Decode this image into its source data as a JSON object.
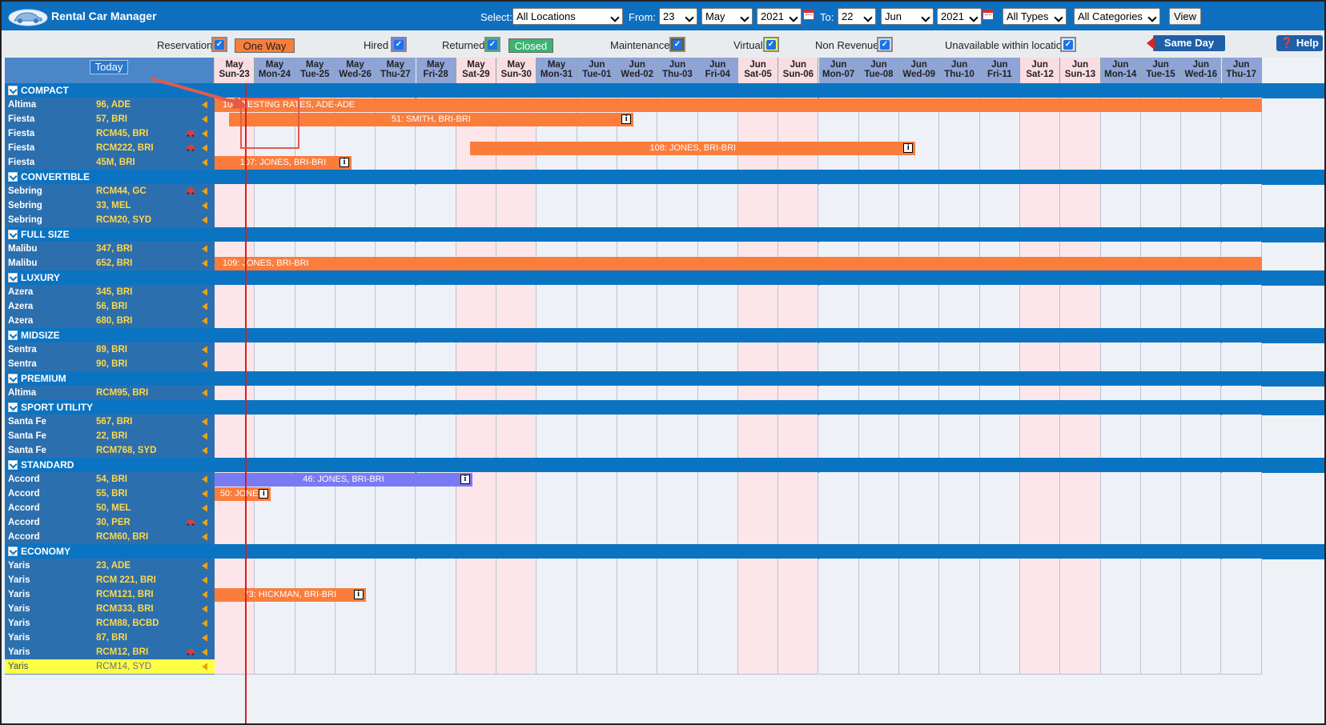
{
  "app": {
    "title": "Rental Car Manager"
  },
  "filters": {
    "select_label": "Select:",
    "location": "All Locations",
    "from_label": "From:",
    "from_day": "23",
    "from_month": "May",
    "from_year": "2021",
    "to_label": "To:",
    "to_day": "22",
    "to_month": "Jun",
    "to_year": "2021",
    "types": "All Types",
    "categories": "All Categories",
    "view_label": "View"
  },
  "legend": {
    "reservation_label": "Reservation",
    "one_way_label": "One Way",
    "hired_label": "Hired",
    "returned_label": "Returned",
    "closed_label": "Closed",
    "maintenance_label": "Maintenance",
    "virtual_label": "Virtual",
    "non_revenue_label": "Non Revenue",
    "unavailable_label": "Unavailable within location",
    "same_day_label": "Same Day",
    "help_label": "Help"
  },
  "colors": {
    "reservation": "#fa7d3c",
    "hired": "#7a7af5",
    "returned": "#7a7af5",
    "closed": "#3cb371",
    "maintenance": "#6b5a1a",
    "virtual": "#ffff44",
    "non_revenue": "#cfd8e3",
    "header_blue": "#0f6fbf"
  },
  "today_label": "Today",
  "days": [
    {
      "m": "May",
      "d": "Sun-23",
      "we": true
    },
    {
      "m": "May",
      "d": "Mon-24",
      "we": false
    },
    {
      "m": "May",
      "d": "Tue-25",
      "we": false
    },
    {
      "m": "May",
      "d": "Wed-26",
      "we": false
    },
    {
      "m": "May",
      "d": "Thu-27",
      "we": false
    },
    {
      "m": "May",
      "d": "Fri-28",
      "we": false
    },
    {
      "m": "May",
      "d": "Sat-29",
      "we": true
    },
    {
      "m": "May",
      "d": "Sun-30",
      "we": true
    },
    {
      "m": "May",
      "d": "Mon-31",
      "we": false
    },
    {
      "m": "Jun",
      "d": "Tue-01",
      "we": false
    },
    {
      "m": "Jun",
      "d": "Wed-02",
      "we": false
    },
    {
      "m": "Jun",
      "d": "Thu-03",
      "we": false
    },
    {
      "m": "Jun",
      "d": "Fri-04",
      "we": false
    },
    {
      "m": "Jun",
      "d": "Sat-05",
      "we": true
    },
    {
      "m": "Jun",
      "d": "Sun-06",
      "we": true
    },
    {
      "m": "Jun",
      "d": "Mon-07",
      "we": false
    },
    {
      "m": "Jun",
      "d": "Tue-08",
      "we": false
    },
    {
      "m": "Jun",
      "d": "Wed-09",
      "we": false
    },
    {
      "m": "Jun",
      "d": "Thu-10",
      "we": false
    },
    {
      "m": "Jun",
      "d": "Fri-11",
      "we": false
    },
    {
      "m": "Jun",
      "d": "Sat-12",
      "we": true
    },
    {
      "m": "Jun",
      "d": "Sun-13",
      "we": true
    },
    {
      "m": "Jun",
      "d": "Mon-14",
      "we": false
    },
    {
      "m": "Jun",
      "d": "Tue-15",
      "we": false
    },
    {
      "m": "Jun",
      "d": "Wed-16",
      "we": false
    },
    {
      "m": "Jun",
      "d": "Thu-17",
      "we": false
    }
  ],
  "groups": [
    {
      "name": "COMPACT",
      "cars": [
        {
          "model": "Altima",
          "plate": "96, ADE",
          "icon": false,
          "bookings": [
            {
              "label": "104: TESTING RATES, ADE-ADE",
              "start": 0,
              "end": 26,
              "color": "reservation",
              "info": false
            }
          ]
        },
        {
          "model": "Fiesta",
          "plate": "57, BRI",
          "icon": false,
          "bookings": [
            {
              "label": "51: SMITH, BRI-BRI",
              "start": 0.35,
              "end": 10.4,
              "color": "reservation",
              "info": true
            }
          ]
        },
        {
          "model": "Fiesta",
          "plate": "RCM45, BRI",
          "icon": true,
          "bookings": []
        },
        {
          "model": "Fiesta",
          "plate": "RCM222, BRI",
          "icon": true,
          "bookings": [
            {
              "label": "108: JONES, BRI-BRI",
              "start": 6.35,
              "end": 17.4,
              "color": "reservation",
              "info": true
            }
          ]
        },
        {
          "model": "Fiesta",
          "plate": "45M, BRI",
          "icon": false,
          "bookings": [
            {
              "label": "107: JONES, BRI-BRI",
              "start": 0,
              "end": 3.4,
              "color": "reservation",
              "info": true
            }
          ]
        }
      ]
    },
    {
      "name": "CONVERTIBLE",
      "cars": [
        {
          "model": "Sebring",
          "plate": "RCM44, GC",
          "icon": true,
          "bookings": []
        },
        {
          "model": "Sebring",
          "plate": "33, MEL",
          "icon": false,
          "bookings": []
        },
        {
          "model": "Sebring",
          "plate": "RCM20, SYD",
          "icon": false,
          "bookings": []
        }
      ]
    },
    {
      "name": "FULL SIZE",
      "cars": [
        {
          "model": "Malibu",
          "plate": "347, BRI",
          "icon": false,
          "bookings": []
        },
        {
          "model": "Malibu",
          "plate": "652, BRI",
          "icon": false,
          "bookings": [
            {
              "label": "109: JONES, BRI-BRI",
              "start": 0,
              "end": 26,
              "color": "reservation",
              "info": false
            }
          ]
        }
      ]
    },
    {
      "name": "LUXURY",
      "cars": [
        {
          "model": "Azera",
          "plate": "345, BRI",
          "icon": false,
          "bookings": []
        },
        {
          "model": "Azera",
          "plate": "56, BRI",
          "icon": false,
          "bookings": []
        },
        {
          "model": "Azera",
          "plate": "680, BRI",
          "icon": false,
          "bookings": []
        }
      ]
    },
    {
      "name": "MIDSIZE",
      "cars": [
        {
          "model": "Sentra",
          "plate": "89, BRI",
          "icon": false,
          "bookings": []
        },
        {
          "model": "Sentra",
          "plate": "90, BRI",
          "icon": false,
          "bookings": []
        }
      ]
    },
    {
      "name": "PREMIUM",
      "cars": [
        {
          "model": "Altima",
          "plate": "RCM95, BRI",
          "icon": false,
          "bookings": []
        }
      ]
    },
    {
      "name": "SPORT UTILITY",
      "cars": [
        {
          "model": "Santa Fe",
          "plate": "567, BRI",
          "icon": false,
          "bookings": []
        },
        {
          "model": "Santa Fe",
          "plate": "22, BRI",
          "icon": false,
          "bookings": []
        },
        {
          "model": "Santa Fe",
          "plate": "RCM768, SYD",
          "icon": false,
          "bookings": []
        }
      ]
    },
    {
      "name": "STANDARD",
      "cars": [
        {
          "model": "Accord",
          "plate": "54, BRI",
          "icon": false,
          "bookings": [
            {
              "label": "46: JONES, BRI-BRI",
              "start": 0,
              "end": 6.4,
              "color": "hired",
              "info": true
            }
          ]
        },
        {
          "model": "Accord",
          "plate": "55, BRI",
          "icon": false,
          "bookings": [
            {
              "label": "50: JONE",
              "start": 0,
              "end": 1.4,
              "color": "reservation",
              "info": true
            }
          ]
        },
        {
          "model": "Accord",
          "plate": "50, MEL",
          "icon": false,
          "bookings": []
        },
        {
          "model": "Accord",
          "plate": "30, PER",
          "icon": true,
          "bookings": []
        },
        {
          "model": "Accord",
          "plate": "RCM60, BRI",
          "icon": false,
          "bookings": []
        }
      ]
    },
    {
      "name": "ECONOMY",
      "cars": [
        {
          "model": "Yaris",
          "plate": "23, ADE",
          "icon": false,
          "bookings": []
        },
        {
          "model": "Yaris",
          "plate": "RCM 221, BRI",
          "icon": false,
          "bookings": []
        },
        {
          "model": "Yaris",
          "plate": "RCM121, BRI",
          "icon": false,
          "bookings": [
            {
              "label": "73: HICKMAN, BRI-BRI",
              "start": 0,
              "end": 3.75,
              "color": "reservation",
              "info": true
            }
          ]
        },
        {
          "model": "Yaris",
          "plate": "RCM333, BRI",
          "icon": false,
          "bookings": []
        },
        {
          "model": "Yaris",
          "plate": "RCM88, BCBD",
          "icon": false,
          "bookings": []
        },
        {
          "model": "Yaris",
          "plate": "87, BRI",
          "icon": false,
          "bookings": []
        },
        {
          "model": "Yaris",
          "plate": "RCM12, BRI",
          "icon": true,
          "bookings": []
        },
        {
          "model": "Yaris",
          "plate": "RCM14, SYD",
          "icon": false,
          "highlight": true,
          "bookings": []
        }
      ]
    }
  ]
}
